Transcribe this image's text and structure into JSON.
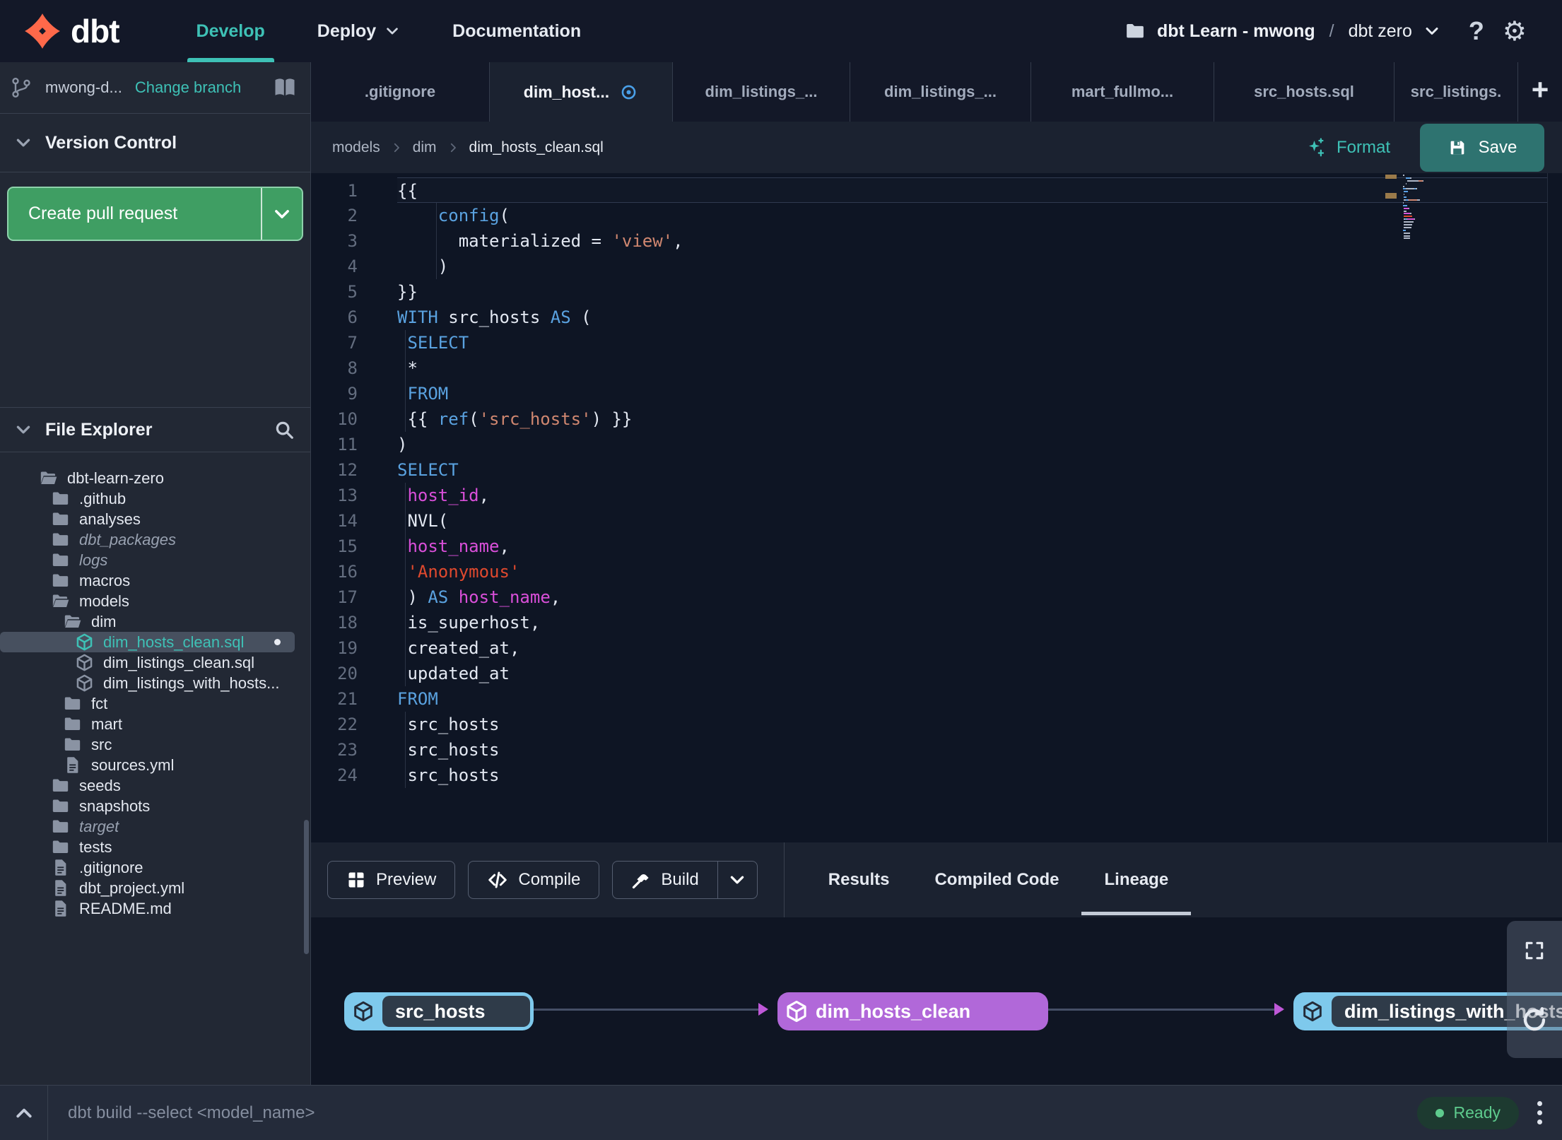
{
  "colors": {
    "accent_teal": "#3ec1b6",
    "logo_orange": "#ff694a",
    "button_green": "#3f9e63",
    "save_teal": "#2e7370",
    "node_cyan": "#7ec9ec",
    "node_purple": "#b168d9",
    "modified_blue": "#4aa0e8",
    "ready_green": "#5ecb8d",
    "keyword_blue": "#5aa2e0",
    "string_salmon": "#d08770",
    "string_red": "#e0492e",
    "identifier_magenta": "#d94fd9"
  },
  "topbar": {
    "brand": "dbt",
    "nav": [
      {
        "label": "Develop",
        "active": true
      },
      {
        "label": "Deploy",
        "active": false
      },
      {
        "label": "Documentation",
        "active": false
      }
    ],
    "project_label": "dbt Learn - mwong",
    "separator": "/",
    "environment_label": "dbt zero"
  },
  "sidebar": {
    "branch": {
      "name": "mwong-d...",
      "change_branch_label": "Change branch"
    },
    "version_control": {
      "title": "Version Control",
      "create_pull_request_label": "Create pull request"
    },
    "file_explorer": {
      "title": "File Explorer",
      "tree": [
        {
          "label": "dbt-learn-zero",
          "icon": "folder-open",
          "depth": 0
        },
        {
          "label": ".github",
          "icon": "folder",
          "depth": 1
        },
        {
          "label": "analyses",
          "icon": "folder",
          "depth": 1
        },
        {
          "label": "dbt_packages",
          "icon": "folder",
          "depth": 1,
          "italic": true
        },
        {
          "label": "logs",
          "icon": "folder",
          "depth": 1,
          "italic": true
        },
        {
          "label": "macros",
          "icon": "folder",
          "depth": 1
        },
        {
          "label": "models",
          "icon": "folder-open",
          "depth": 1
        },
        {
          "label": "dim",
          "icon": "folder-open",
          "depth": 2
        },
        {
          "label": "dim_hosts_clean.sql",
          "icon": "model",
          "depth": 3,
          "selected": true,
          "modified": true
        },
        {
          "label": "dim_listings_clean.sql",
          "icon": "model",
          "depth": 3
        },
        {
          "label": "dim_listings_with_hosts...",
          "icon": "model",
          "depth": 3
        },
        {
          "label": "fct",
          "icon": "folder",
          "depth": 2
        },
        {
          "label": "mart",
          "icon": "folder",
          "depth": 2
        },
        {
          "label": "src",
          "icon": "folder",
          "depth": 2
        },
        {
          "label": "sources.yml",
          "icon": "file",
          "depth": 2
        },
        {
          "label": "seeds",
          "icon": "folder",
          "depth": 1
        },
        {
          "label": "snapshots",
          "icon": "folder",
          "depth": 1
        },
        {
          "label": "target",
          "icon": "folder",
          "depth": 1,
          "italic": true
        },
        {
          "label": "tests",
          "icon": "folder",
          "depth": 1
        },
        {
          "label": ".gitignore",
          "icon": "file",
          "depth": 1
        },
        {
          "label": "dbt_project.yml",
          "icon": "file",
          "depth": 1
        },
        {
          "label": "README.md",
          "icon": "file",
          "depth": 1
        }
      ]
    }
  },
  "tabs": {
    "items": [
      {
        "label": ".gitignore"
      },
      {
        "label": "dim_host...",
        "active": true,
        "modified": true
      },
      {
        "label": "dim_listings_..."
      },
      {
        "label": "dim_listings_..."
      },
      {
        "label": "mart_fullmo..."
      },
      {
        "label": "src_hosts.sql"
      },
      {
        "label": "src_listings."
      }
    ],
    "new_tab_label": "+"
  },
  "editor": {
    "breadcrumb": {
      "items": [
        "models",
        "dim",
        "dim_hosts_clean.sql"
      ]
    },
    "format_label": "Format",
    "save_label": "Save",
    "code_lines": [
      {
        "n": 1,
        "cur": true,
        "t": [
          [
            "p",
            "{{"
          ]
        ]
      },
      {
        "n": 2,
        "g": [
          4
        ],
        "t": [
          [
            "p",
            "    "
          ],
          [
            "k",
            "config"
          ],
          [
            "p",
            "("
          ]
        ]
      },
      {
        "n": 3,
        "g": [
          4
        ],
        "t": [
          [
            "p",
            "      materialized = "
          ],
          [
            "s",
            "'view'"
          ],
          [
            "p",
            ","
          ]
        ]
      },
      {
        "n": 4,
        "g": [
          4
        ],
        "t": [
          [
            "p",
            "    )"
          ]
        ]
      },
      {
        "n": 5,
        "t": [
          [
            "p",
            "}}"
          ]
        ]
      },
      {
        "n": 6,
        "t": [
          [
            "k",
            "WITH"
          ],
          [
            "p",
            " src_hosts "
          ],
          [
            "k",
            "AS"
          ],
          [
            "p",
            " ("
          ]
        ]
      },
      {
        "n": 7,
        "g": [
          1
        ],
        "t": [
          [
            "p",
            " "
          ],
          [
            "k",
            "SELECT"
          ]
        ]
      },
      {
        "n": 8,
        "g": [
          1
        ],
        "t": [
          [
            "p",
            " *"
          ]
        ]
      },
      {
        "n": 9,
        "g": [
          1
        ],
        "t": [
          [
            "p",
            " "
          ],
          [
            "k",
            "FROM"
          ]
        ]
      },
      {
        "n": 10,
        "g": [
          1
        ],
        "t": [
          [
            "p",
            " {{ "
          ],
          [
            "k",
            "ref"
          ],
          [
            "p",
            "("
          ],
          [
            "s",
            "'src_hosts'"
          ],
          [
            "p",
            ") }}"
          ]
        ]
      },
      {
        "n": 11,
        "t": [
          [
            "p",
            ")"
          ]
        ]
      },
      {
        "n": 12,
        "t": [
          [
            "k",
            "SELECT"
          ]
        ]
      },
      {
        "n": 13,
        "g": [
          1
        ],
        "t": [
          [
            "p",
            " "
          ],
          [
            "m",
            "host_id"
          ],
          [
            "p",
            ","
          ]
        ]
      },
      {
        "n": 14,
        "g": [
          1
        ],
        "t": [
          [
            "p",
            " NVL("
          ]
        ]
      },
      {
        "n": 15,
        "g": [
          1
        ],
        "t": [
          [
            "p",
            " "
          ],
          [
            "m",
            "host_name"
          ],
          [
            "p",
            ","
          ]
        ]
      },
      {
        "n": 16,
        "g": [
          1
        ],
        "t": [
          [
            "p",
            " "
          ],
          [
            "r",
            "'Anonymous'"
          ]
        ]
      },
      {
        "n": 17,
        "g": [
          1
        ],
        "t": [
          [
            "p",
            " ) "
          ],
          [
            "k",
            "AS"
          ],
          [
            "p",
            " "
          ],
          [
            "m",
            "host_name"
          ],
          [
            "p",
            ","
          ]
        ]
      },
      {
        "n": 18,
        "g": [
          1
        ],
        "t": [
          [
            "p",
            " is_superhost,"
          ]
        ]
      },
      {
        "n": 19,
        "g": [
          1
        ],
        "t": [
          [
            "p",
            " created_at,"
          ]
        ]
      },
      {
        "n": 20,
        "g": [
          1
        ],
        "t": [
          [
            "p",
            " updated_at"
          ]
        ]
      },
      {
        "n": 21,
        "t": [
          [
            "k",
            "FROM"
          ]
        ]
      },
      {
        "n": 22,
        "g": [
          1
        ],
        "t": [
          [
            "p",
            " src_hosts"
          ]
        ]
      },
      {
        "n": 23,
        "g": [
          1
        ],
        "t": [
          [
            "p",
            " src_hosts"
          ]
        ]
      },
      {
        "n": 24,
        "g": [
          1
        ],
        "t": [
          [
            "p",
            " src_hosts"
          ]
        ]
      }
    ]
  },
  "bottom_panel": {
    "preview_label": "Preview",
    "compile_label": "Compile",
    "build_label": "Build",
    "tabs": [
      {
        "label": "Results",
        "active": false
      },
      {
        "label": "Compiled Code",
        "active": false
      },
      {
        "label": "Lineage",
        "active": true
      }
    ],
    "lineage": {
      "nodes": [
        {
          "label": "src_hosts",
          "style": "cyan"
        },
        {
          "label": "dim_hosts_clean",
          "style": "purple"
        },
        {
          "label": "dim_listings_with_hosts",
          "style": "cyan"
        }
      ]
    }
  },
  "statusbar": {
    "command": "dbt build --select <model_name>",
    "status_label": "Ready"
  }
}
